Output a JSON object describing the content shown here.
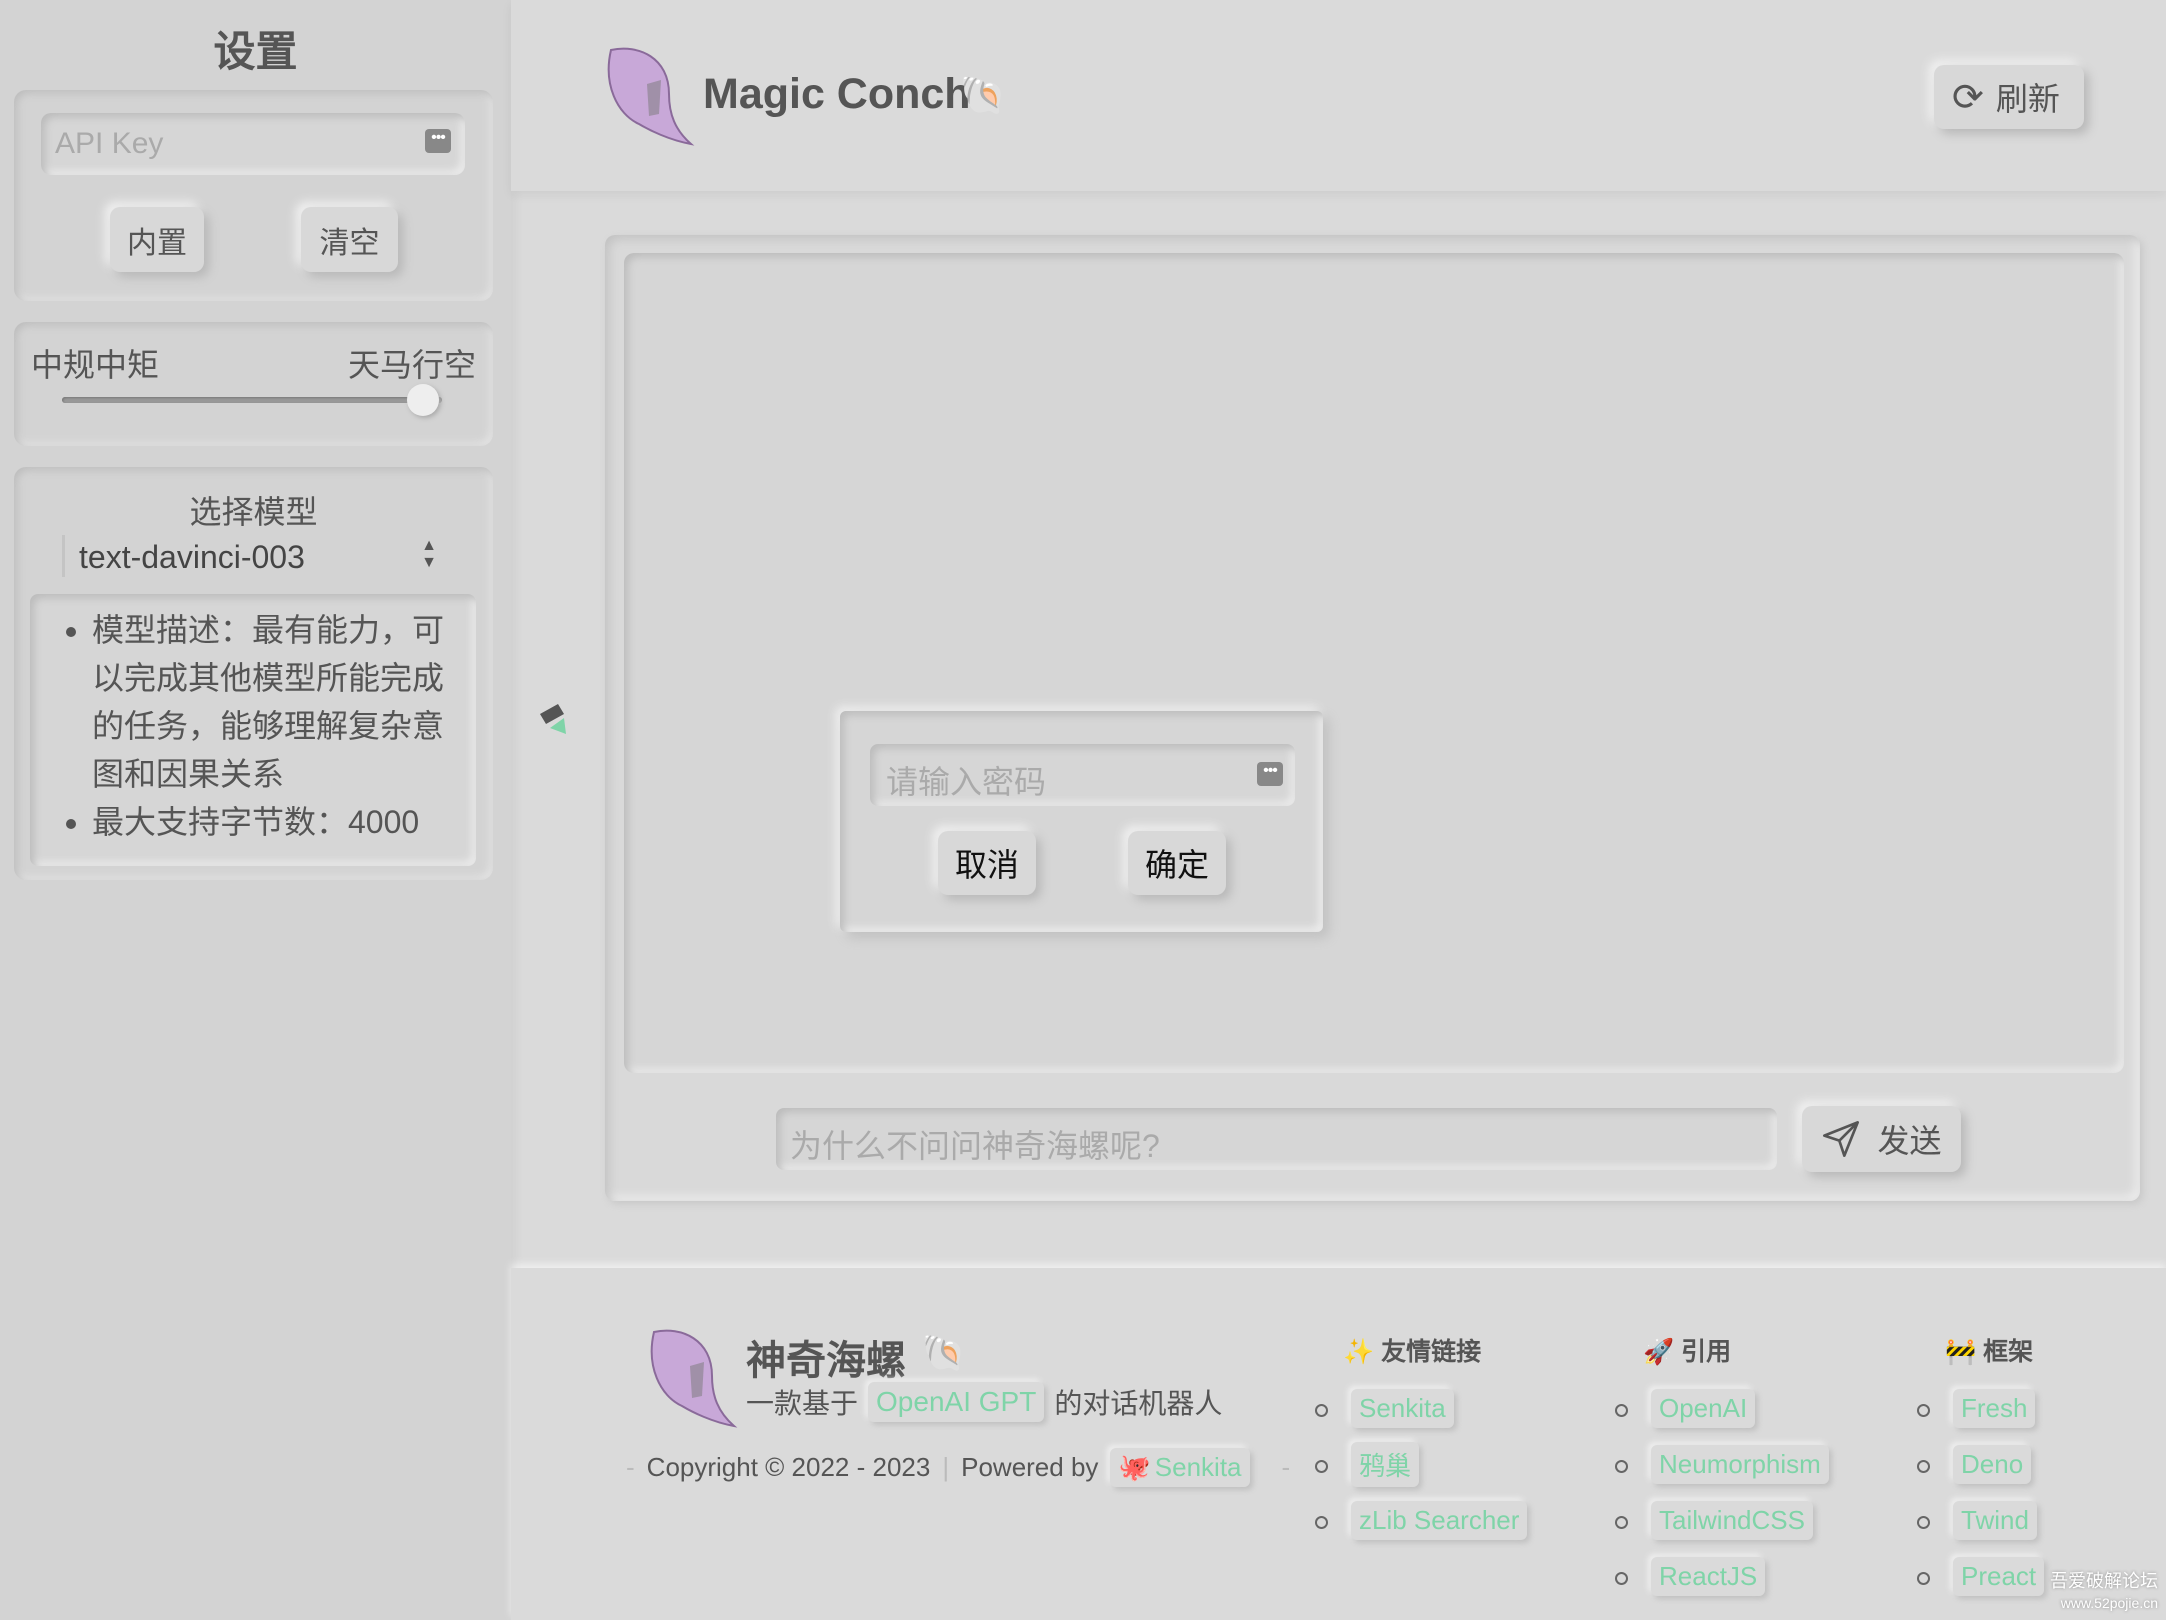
{
  "sidebar": {
    "title": "设置",
    "api_key_placeholder": "API Key",
    "builtin_label": "内置",
    "clear_label": "清空",
    "temperature": {
      "left_label": "中规中矩",
      "right_label": "天马行空",
      "value": 0.95
    },
    "model_label": "选择模型",
    "model_selected": "text-davinci-003",
    "model_info": [
      "模型描述：最有能力，可以完成其他模型所能完成的任务，能够理解复杂意图和因果关系",
      "最大支持字节数：4000"
    ]
  },
  "header": {
    "title": "Magic Conch",
    "refresh_label": "刷新"
  },
  "dialog": {
    "password_placeholder": "请输入密码",
    "cancel_label": "取消",
    "confirm_label": "确定"
  },
  "chat": {
    "input_placeholder": "为什么不问问神奇海螺呢?",
    "send_label": "发送"
  },
  "footer": {
    "title": "神奇海螺",
    "subtitle_prefix": "一款基于",
    "subtitle_link": "OpenAI GPT",
    "subtitle_suffix": "的对话机器人",
    "copyright": "Copyright © 2022 - 2023",
    "powered_by": "Powered by",
    "powered_link": "Senkita",
    "columns": [
      {
        "title": "友情链接",
        "icon": "sparkles-icon",
        "items": [
          "Senkita",
          "鸦巢",
          "zLib Searcher"
        ]
      },
      {
        "title": "引用",
        "icon": "rocket-icon",
        "items": [
          "OpenAI",
          "Neumorphism",
          "TailwindCSS",
          "ReactJS"
        ]
      },
      {
        "title": "框架",
        "icon": "construction-icon",
        "items": [
          "Fresh",
          "Deno",
          "Twind",
          "Preact"
        ]
      }
    ]
  },
  "watermark": [
    "吾爱破解论坛",
    "www.52pojie.cn"
  ],
  "colors": {
    "accent": "#7fd4a8",
    "conch": "#c8a8d8"
  }
}
